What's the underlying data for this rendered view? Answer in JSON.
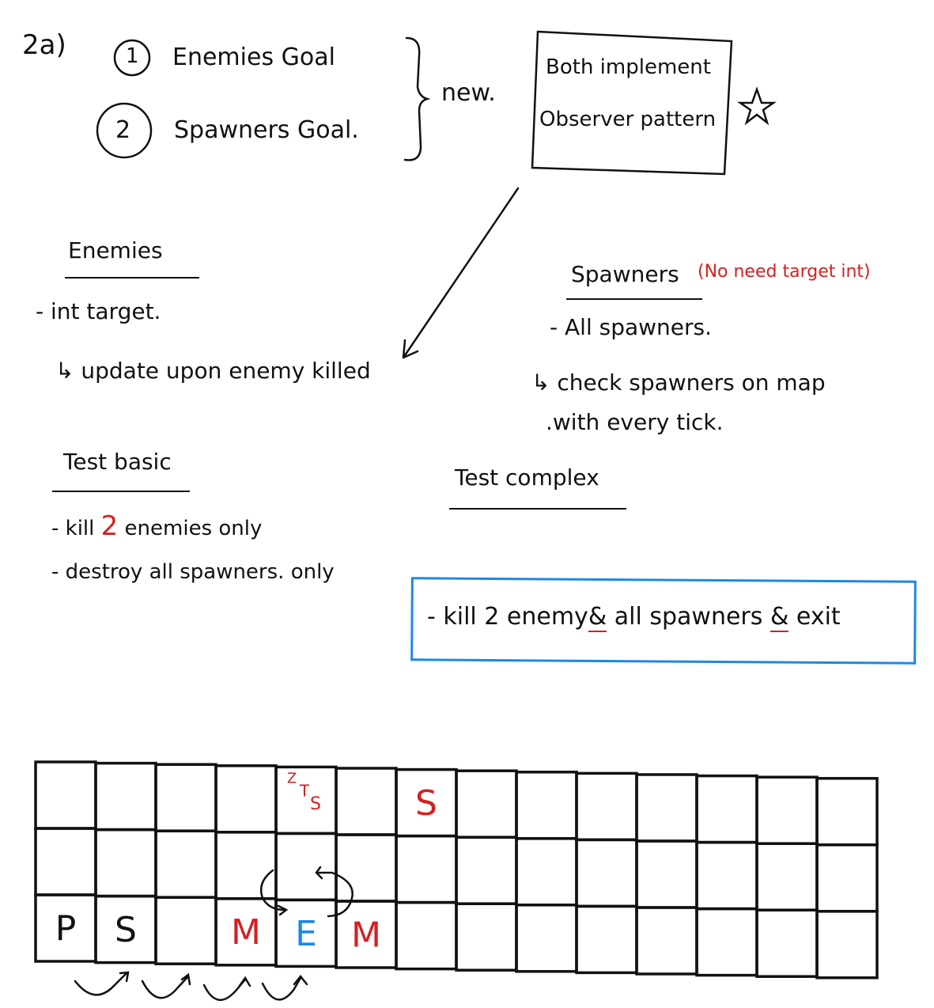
{
  "heading": {
    "label": "2a)"
  },
  "goals": [
    {
      "number": "1",
      "text": "Enemies Goal"
    },
    {
      "number": "2",
      "text": "Spawners Goal."
    }
  ],
  "new_label": "new.",
  "pattern_box": {
    "line1": "Both implement",
    "line2": "Observer pattern",
    "star": "☆"
  },
  "enemies": {
    "title": "Enemies",
    "item": "- int target.",
    "note": "↳ update upon enemy killed"
  },
  "spawners": {
    "title": "Spawners",
    "annotation": "(No need target int)",
    "item": "- All spawners.",
    "note_line1": "↳ check spawners on map",
    "note_line2": ".with every tick."
  },
  "test_basic": {
    "title": "Test basic",
    "item1_prefix": "- kill",
    "item1_number": "2",
    "item1_suffix": "enemies only",
    "item2": "- destroy all spawners. only"
  },
  "test_complex": {
    "title": "Test complex",
    "item_part1": "- kill 2 enemy",
    "amp1": "&",
    "item_part2": "all spawners",
    "amp2": "&",
    "item_part3": "exit"
  },
  "grid": {
    "columns": 14,
    "rows": [
      [
        {
          "c": 4,
          "text": "Z",
          "color": "#d42020",
          "kind": "sleep-z"
        },
        {
          "c": 4,
          "text": "T",
          "color": "#d42020",
          "kind": "sleep-t"
        },
        {
          "c": 4,
          "text": "S",
          "color": "#d42020",
          "kind": "sleep-s"
        },
        {
          "c": 6,
          "text": "S",
          "color": "#d42020"
        }
      ],
      [],
      [
        {
          "c": 0,
          "text": "P",
          "color": "#111111"
        },
        {
          "c": 1,
          "text": "S",
          "color": "#111111"
        },
        {
          "c": 3,
          "text": "M",
          "color": "#d42020"
        },
        {
          "c": 4,
          "text": "E",
          "color": "#1e88e5"
        },
        {
          "c": 5,
          "text": "M",
          "color": "#d42020"
        }
      ]
    ]
  },
  "colors": {
    "ink": "#111111",
    "red": "#d42020",
    "blue": "#1e88e5"
  }
}
